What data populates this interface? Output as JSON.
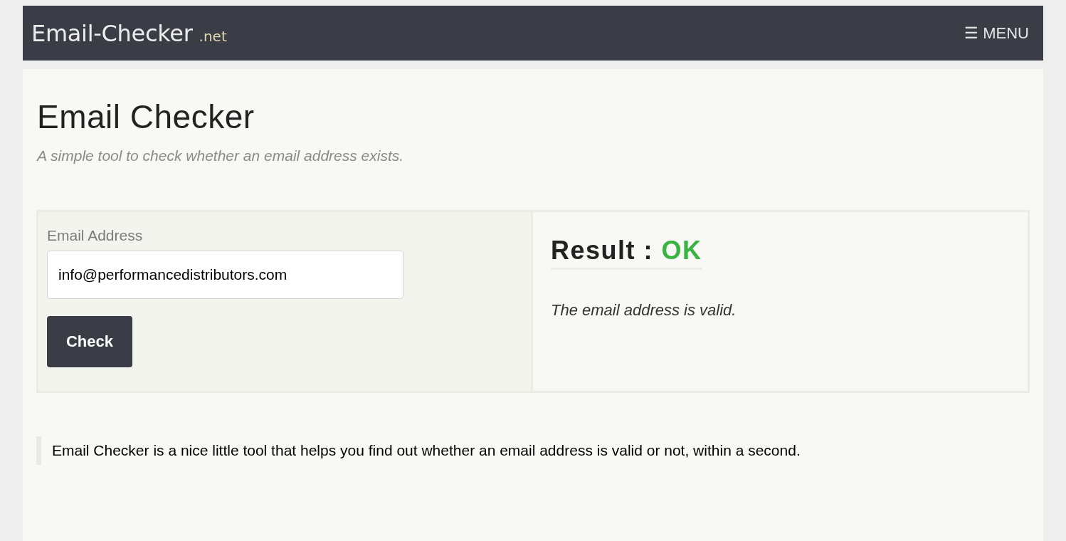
{
  "header": {
    "logo": {
      "name": "Email-Checker",
      "suffix": ".net"
    },
    "menu_button": "☰ MENU"
  },
  "page": {
    "title": "Email Checker",
    "subtitle": "A simple tool to check whether an email address exists."
  },
  "form": {
    "label": "Email Address",
    "value": "info@performancedistributors.com",
    "button": "Check"
  },
  "result": {
    "label": "Result :",
    "value": "OK",
    "kind": "valid",
    "message": "The email address is valid."
  },
  "note": "Email Checker is a nice little tool that helps you find out whether an email address is valid or not, within a second."
}
